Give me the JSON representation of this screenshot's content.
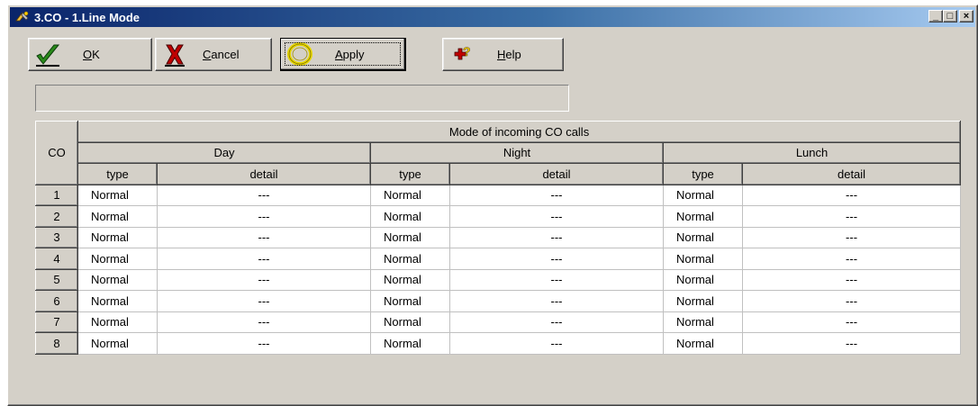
{
  "window": {
    "title": "3.CO - 1.Line Mode",
    "controls": [
      "_",
      "□",
      "×"
    ]
  },
  "toolbar": {
    "ok": {
      "label_u": "O",
      "label_rest": "K",
      "icon": "checkmark-icon",
      "color": "#2a8a1a"
    },
    "cancel": {
      "label_u": "C",
      "label_rest": "ancel",
      "icon": "x-icon",
      "color": "#c00000"
    },
    "apply": {
      "label_u": "A",
      "label_rest": "pply",
      "icon": "ring-icon",
      "color": "#e8d800"
    },
    "help": {
      "label_u": "H",
      "label_rest": "elp",
      "icon": "help-icon",
      "color": "#c00000"
    }
  },
  "status_text": "",
  "table": {
    "corner": "CO",
    "group_header": "Mode of incoming CO calls",
    "periods": [
      "Day",
      "Night",
      "Lunch"
    ],
    "sub_headers": {
      "type": "type",
      "detail": "detail"
    },
    "rows": [
      {
        "co": "1",
        "day_type": "Normal",
        "day_detail": "---",
        "night_type": "Normal",
        "night_detail": "---",
        "lunch_type": "Normal",
        "lunch_detail": "---"
      },
      {
        "co": "2",
        "day_type": "Normal",
        "day_detail": "---",
        "night_type": "Normal",
        "night_detail": "---",
        "lunch_type": "Normal",
        "lunch_detail": "---"
      },
      {
        "co": "3",
        "day_type": "Normal",
        "day_detail": "---",
        "night_type": "Normal",
        "night_detail": "---",
        "lunch_type": "Normal",
        "lunch_detail": "---"
      },
      {
        "co": "4",
        "day_type": "Normal",
        "day_detail": "---",
        "night_type": "Normal",
        "night_detail": "---",
        "lunch_type": "Normal",
        "lunch_detail": "---"
      },
      {
        "co": "5",
        "day_type": "Normal",
        "day_detail": "---",
        "night_type": "Normal",
        "night_detail": "---",
        "lunch_type": "Normal",
        "lunch_detail": "---"
      },
      {
        "co": "6",
        "day_type": "Normal",
        "day_detail": "---",
        "night_type": "Normal",
        "night_detail": "---",
        "lunch_type": "Normal",
        "lunch_detail": "---"
      },
      {
        "co": "7",
        "day_type": "Normal",
        "day_detail": "---",
        "night_type": "Normal",
        "night_detail": "---",
        "lunch_type": "Normal",
        "lunch_detail": "---"
      },
      {
        "co": "8",
        "day_type": "Normal",
        "day_detail": "---",
        "night_type": "Normal",
        "night_detail": "---",
        "lunch_type": "Normal",
        "lunch_detail": "---"
      }
    ]
  }
}
